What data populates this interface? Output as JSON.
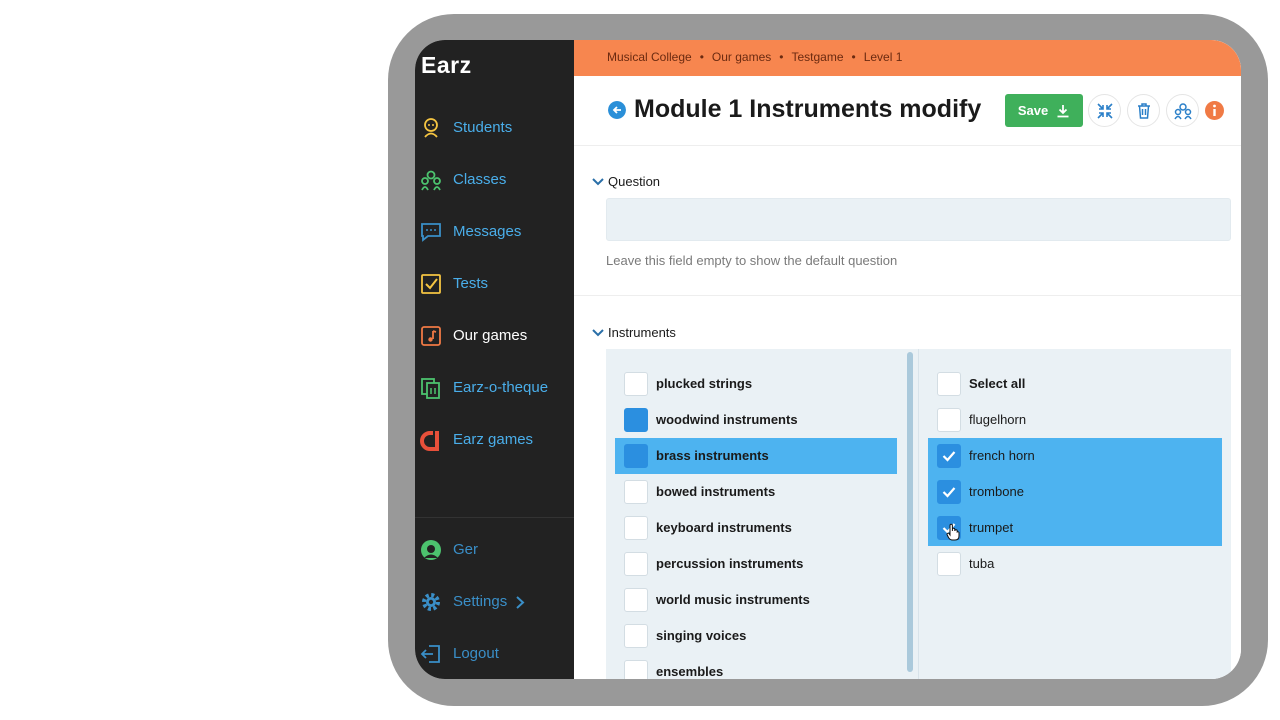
{
  "app": {
    "logo": "Earz"
  },
  "sidebar": {
    "items": [
      {
        "label": "Students",
        "icon": "student-icon",
        "color": "#f5c542"
      },
      {
        "label": "Classes",
        "icon": "classes-icon",
        "color": "#4cc36e"
      },
      {
        "label": "Messages",
        "icon": "messages-icon",
        "color": "#3a8fc8"
      },
      {
        "label": "Tests",
        "icon": "tests-icon",
        "color": "#f5c542"
      },
      {
        "label": "Our games",
        "icon": "music-note-icon",
        "color": "#f07a45"
      },
      {
        "label": "Earz-o-theque",
        "icon": "library-icon",
        "color": "#4cc36e"
      },
      {
        "label": "Earz games",
        "icon": "earz-games-icon",
        "color": "#e8503a"
      }
    ],
    "bottom": [
      {
        "label": "Ger",
        "icon": "avatar-icon"
      },
      {
        "label": "Settings",
        "icon": "gear-icon"
      },
      {
        "label": "Logout",
        "icon": "logout-icon"
      }
    ],
    "active": "Our games"
  },
  "breadcrumb": [
    "Musical College",
    "Our games",
    "Testgame",
    "Level 1"
  ],
  "header": {
    "title": "Module 1 Instruments modify",
    "save_label": "Save"
  },
  "question": {
    "section_title": "Question",
    "input_value": "",
    "hint": "Leave this field empty to show the default question"
  },
  "instruments": {
    "section_title": "Instruments",
    "categories": [
      {
        "label": "plucked strings",
        "state": "empty",
        "selected": false
      },
      {
        "label": "woodwind instruments",
        "state": "partial",
        "selected": false
      },
      {
        "label": "brass instruments",
        "state": "partial",
        "selected": true
      },
      {
        "label": "bowed instruments",
        "state": "empty",
        "selected": false
      },
      {
        "label": "keyboard instruments",
        "state": "empty",
        "selected": false
      },
      {
        "label": "percussion instruments",
        "state": "empty",
        "selected": false
      },
      {
        "label": "world music instruments",
        "state": "empty",
        "selected": false
      },
      {
        "label": "singing voices",
        "state": "empty",
        "selected": false
      },
      {
        "label": "ensembles",
        "state": "empty",
        "selected": false
      }
    ],
    "items": [
      {
        "label": "Select all",
        "checked": false,
        "bold": true
      },
      {
        "label": "flugelhorn",
        "checked": false,
        "bold": false
      },
      {
        "label": "french horn",
        "checked": true,
        "bold": false
      },
      {
        "label": "trombone",
        "checked": true,
        "bold": false
      },
      {
        "label": "trumpet",
        "checked": true,
        "bold": false
      },
      {
        "label": "tuba",
        "checked": false,
        "bold": false
      }
    ]
  },
  "colors": {
    "accent": "#f7864f",
    "sidebar": "#222222",
    "link": "#4aaeea",
    "save": "#3fb05b",
    "selection": "#4db3f0"
  }
}
